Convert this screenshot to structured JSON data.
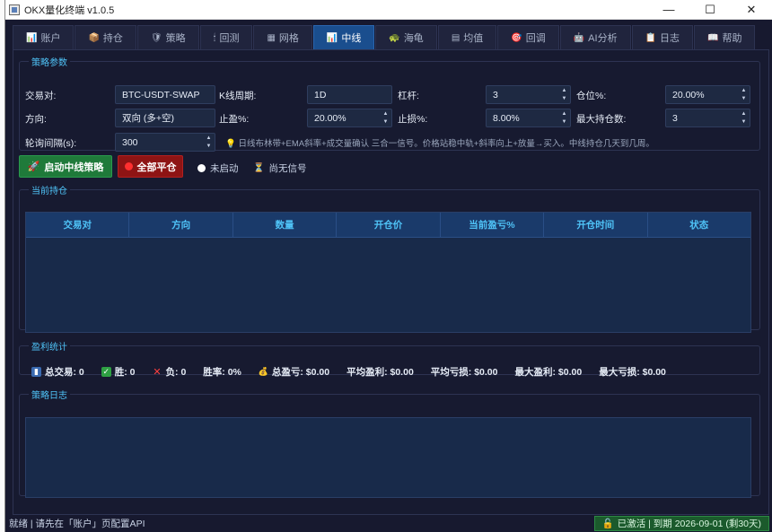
{
  "window": {
    "title": "OKX量化终端 v1.0.5"
  },
  "window_controls": {
    "minimize": "—",
    "maximize": "☐",
    "close": "✕"
  },
  "tabs": [
    {
      "label": "账户",
      "icon": "📊"
    },
    {
      "label": "持仓",
      "icon": "📦"
    },
    {
      "label": "策略",
      "icon": "🛡"
    },
    {
      "label": "回测",
      "icon": "🕯"
    },
    {
      "label": "网格",
      "icon": "▦"
    },
    {
      "label": "中线",
      "icon": "📊"
    },
    {
      "label": "海龟",
      "icon": "🐢"
    },
    {
      "label": "均值",
      "icon": "▤"
    },
    {
      "label": "回调",
      "icon": "🎯"
    },
    {
      "label": "AI分析",
      "icon": "🤖"
    },
    {
      "label": "日志",
      "icon": "📋"
    },
    {
      "label": "帮助",
      "icon": "📖"
    }
  ],
  "params": {
    "legend": "策略参数",
    "pair_label": "交易对:",
    "pair_value": "BTC-USDT-SWAP",
    "kline_label": "K线周期:",
    "kline_value": "1D",
    "leverage_label": "杠杆:",
    "leverage_value": "3",
    "position_label": "仓位%:",
    "position_value": "20.00%",
    "direction_label": "方向:",
    "direction_value": "双向 (多+空)",
    "tp_label": "止盈%:",
    "tp_value": "20.00%",
    "sl_label": "止损%:",
    "sl_value": "8.00%",
    "maxpos_label": "最大持仓数:",
    "maxpos_value": "3",
    "interval_label": "轮询间隔(s):",
    "interval_value": "300",
    "hint": "日线布林带+EMA斜率+成交量确认 三合一信号。价格站稳中轨+斜率向上+放量→买入。中线持仓几天到几周。"
  },
  "controls": {
    "start_label": "启动中线策略",
    "close_all_label": "全部平仓",
    "run_status": "未启动",
    "signal_status": "尚无信号"
  },
  "positions": {
    "legend": "当前持仓",
    "columns": [
      "交易对",
      "方向",
      "数量",
      "开仓价",
      "当前盈亏%",
      "开仓时间",
      "状态"
    ]
  },
  "pnl": {
    "legend": "盈利统计",
    "total_trades": "总交易: 0",
    "wins": "胜: 0",
    "losses": "负: 0",
    "win_rate": "胜率: 0%",
    "total_pnl": "总盈亏: $0.00",
    "avg_profit": "平均盈利: $0.00",
    "avg_loss": "平均亏损: $0.00",
    "max_profit": "最大盈利: $0.00",
    "max_loss": "最大亏损: $0.00"
  },
  "log": {
    "legend": "策略日志"
  },
  "statusbar": {
    "message": "就绪 | 请先在「账户」页配置API",
    "activation": "已激活 | 到期 2026-09-01 (剩30天)"
  },
  "colors": {
    "accent": "#4fc3f7",
    "active_tab": "#1a4e8e",
    "start": "#1f7a3a",
    "danger": "#8e1414",
    "panel": "#17192f"
  }
}
